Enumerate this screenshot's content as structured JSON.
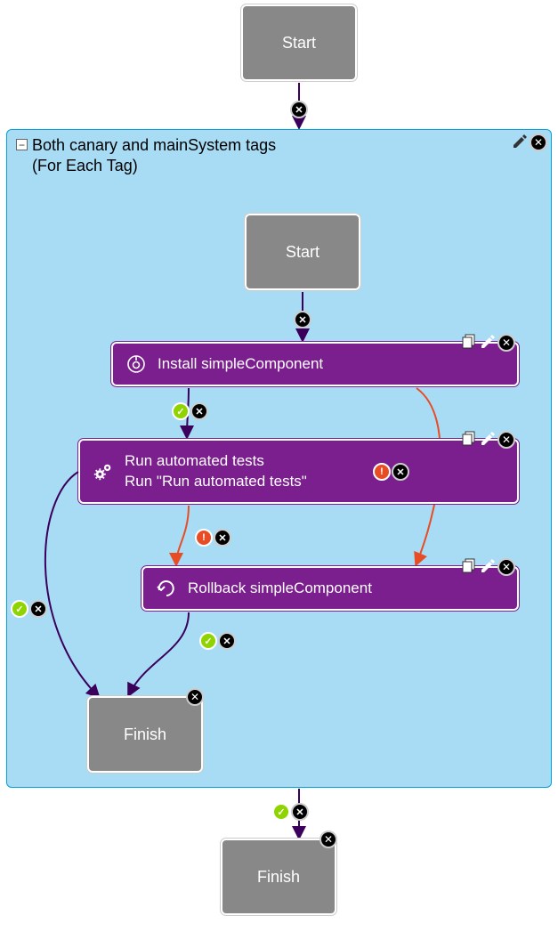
{
  "outer": {
    "start": "Start",
    "finish": "Finish"
  },
  "container": {
    "title_line1": "Both canary and mainSystem tags",
    "title_line2": "(For Each Tag)"
  },
  "inner": {
    "start": "Start",
    "finish": "Finish",
    "install": {
      "label": "Install simpleComponent"
    },
    "tests": {
      "label_line1": "Run automated tests",
      "label_line2": "Run \"Run automated tests\""
    },
    "rollback": {
      "label": "Rollback simpleComponent"
    }
  },
  "colors": {
    "grey": "#888888",
    "purple": "#7b1e8e",
    "blue_fill": "#a8dcf5",
    "blue_border": "#00a3e0",
    "green": "#8fd400",
    "red": "#e84c24",
    "black": "#000000"
  }
}
